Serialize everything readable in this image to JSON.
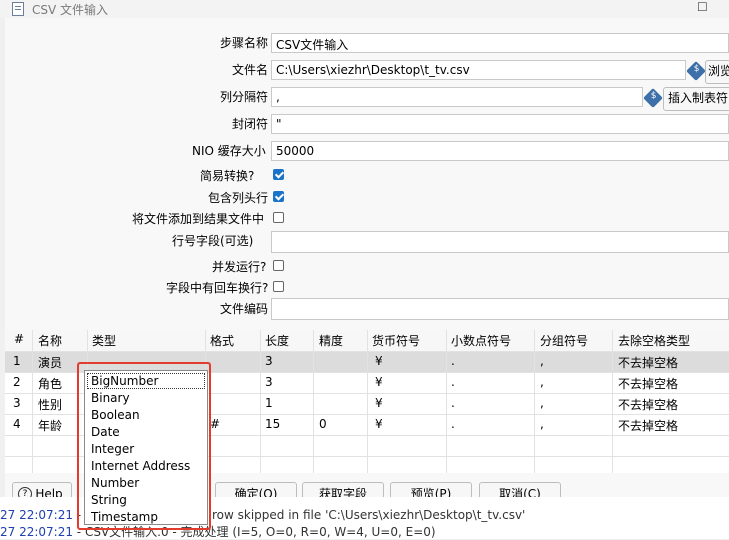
{
  "window": {
    "title": "CSV 文件输入",
    "maximize": "☐"
  },
  "form": {
    "step_name_label": "步骤名称",
    "step_name_value": "CSV文件输入",
    "filename_label": "文件名",
    "filename_value": "C:\\Users\\xiezhr\\Desktop\\t_tv.csv",
    "browse_label": "浏览",
    "delimiter_label": "列分隔符",
    "delimiter_value": ",",
    "insert_tab_label": "插入制表符",
    "enclosure_label": "封闭符",
    "enclosure_value": "\"",
    "nio_label": "NIO 缓存大小",
    "nio_value": "50000",
    "lazy_label": "简易转换?",
    "lazy_checked": true,
    "header_label": "包含列头行",
    "header_checked": true,
    "add_result_label": "将文件添加到结果文件中",
    "add_result_checked": false,
    "rownum_label": "行号字段(可选)",
    "rownum_value": "",
    "parallel_label": "并发运行?",
    "parallel_checked": false,
    "newline_label": "字段中有回车换行?",
    "newline_checked": false,
    "encoding_label": "文件编码",
    "encoding_value": ""
  },
  "table": {
    "headers": [
      "#",
      "名称",
      "类型",
      "格式",
      "长度",
      "精度",
      "货币符号",
      "小数点符号",
      "分组符号",
      "去除空格类型"
    ],
    "rows": [
      {
        "num": "1",
        "name": "演员",
        "type": "",
        "format": "",
        "length": "3",
        "precision": "",
        "currency": "¥",
        "decimal": ".",
        "group": ",",
        "trim": "不去掉空格"
      },
      {
        "num": "2",
        "name": "角色",
        "type": "",
        "format": "",
        "length": "3",
        "precision": "",
        "currency": "¥",
        "decimal": ".",
        "group": ",",
        "trim": "不去掉空格"
      },
      {
        "num": "3",
        "name": "性别",
        "type": "",
        "format": "",
        "length": "1",
        "precision": "",
        "currency": "¥",
        "decimal": ".",
        "group": ",",
        "trim": "不去掉空格"
      },
      {
        "num": "4",
        "name": "年龄",
        "type": "",
        "format": "#",
        "length": "15",
        "precision": "0",
        "currency": "¥",
        "decimal": ".",
        "group": ",",
        "trim": "不去掉空格"
      }
    ]
  },
  "type_dropdown": {
    "selected": "BigNumber",
    "options": [
      "BigNumber",
      "Binary",
      "Boolean",
      "Date",
      "Integer",
      "Internet Address",
      "Number",
      "String",
      "Timestamp"
    ]
  },
  "buttons": {
    "help": "Help",
    "ok": "确定(O)",
    "get_fields": "获取字段",
    "preview": "预览(P)",
    "cancel": "取消(C)"
  },
  "log": {
    "line1_time": "27 22:07:21",
    "line1_text": " - C",
    "line1_tail": "row skipped in file 'C:\\Users\\xiezhr\\Desktop\\t_tv.csv'",
    "line2_time": "27 22:07:21",
    "line2_text": " - CSV文件输入.0 - 完成处理 (I=5, O=0, R=0, W=4, U=0, E=0)"
  },
  "colors": {
    "accent": "#1a73c9",
    "highlight": "#e33b2e",
    "selected_row": "#dcdcdc"
  }
}
